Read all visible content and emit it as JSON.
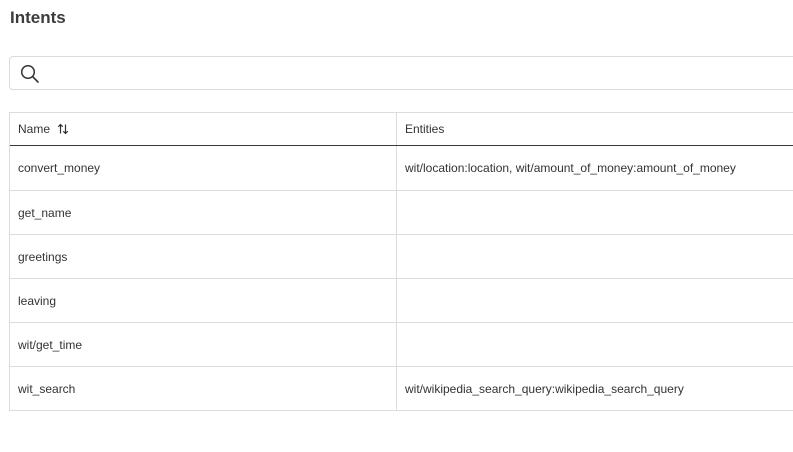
{
  "page": {
    "title": "Intents"
  },
  "search": {
    "placeholder": "",
    "value": "",
    "icon": "search-icon"
  },
  "table": {
    "columns": {
      "name": "Name",
      "name_sort_icon": "sort-icon",
      "entities": "Entities"
    },
    "rows": [
      {
        "name": "convert_money",
        "entities": "wit/location:location, wit/amount_of_money:amount_of_money"
      },
      {
        "name": "get_name",
        "entities": ""
      },
      {
        "name": "greetings",
        "entities": ""
      },
      {
        "name": "leaving",
        "entities": ""
      },
      {
        "name": "wit/get_time",
        "entities": ""
      },
      {
        "name": "wit_search",
        "entities": "wit/wikipedia_search_query:wikipedia_search_query"
      }
    ]
  }
}
